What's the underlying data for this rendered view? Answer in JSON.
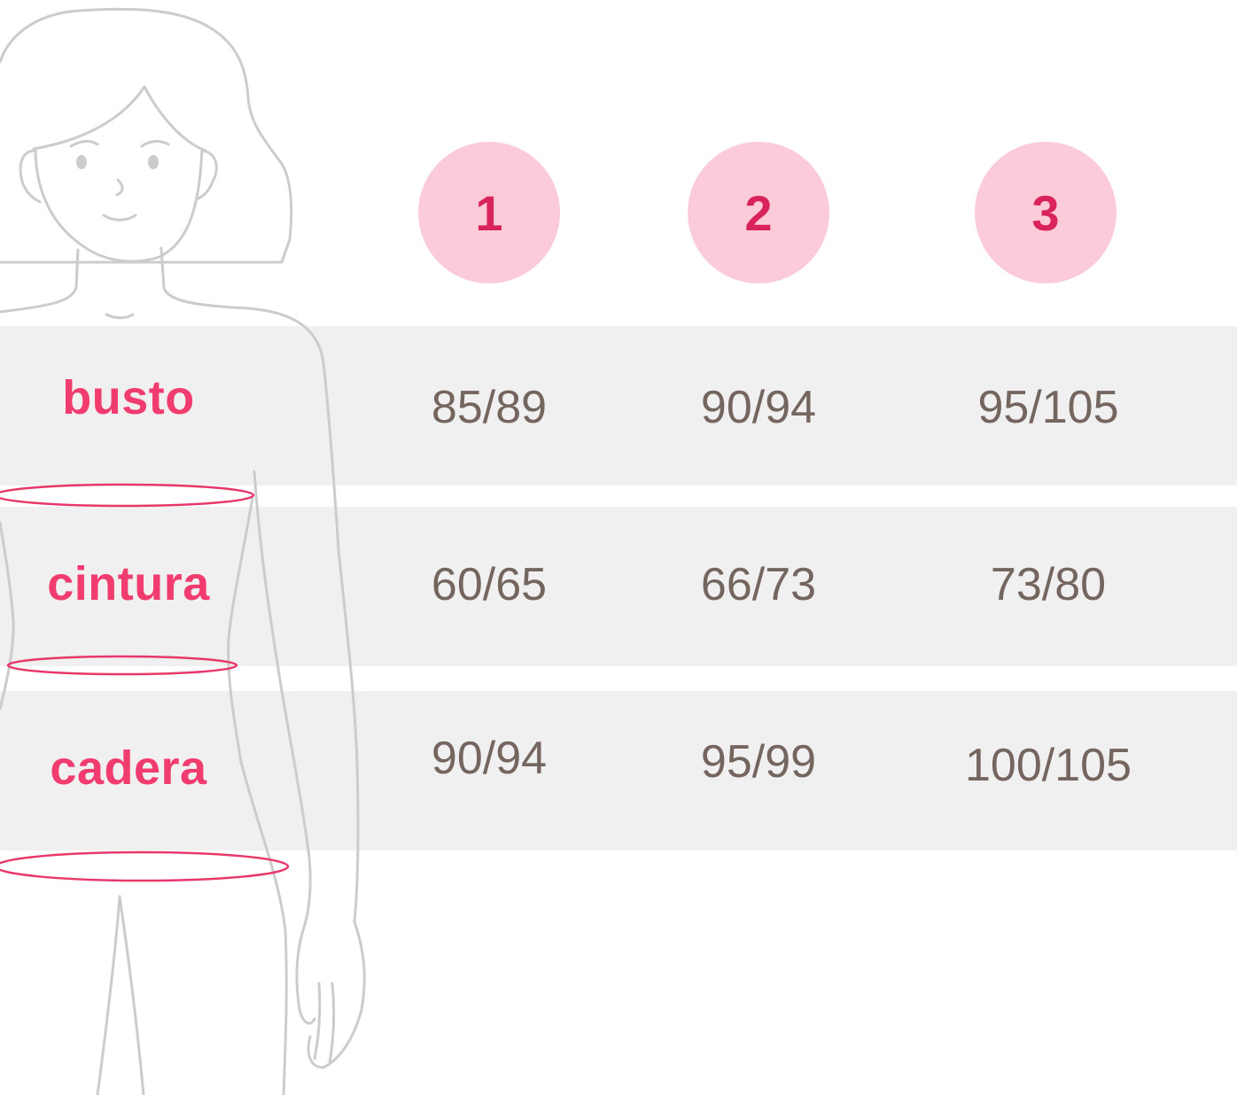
{
  "colors": {
    "label": "#f03c6e",
    "value": "#75655f",
    "badge_bg": "#fccbda",
    "badge_text": "#d8245a",
    "band": "#f0f0f0",
    "outline": "#cccccc",
    "measure_ring": "#e8386a"
  },
  "sizes": [
    "1",
    "2",
    "3"
  ],
  "rows": [
    {
      "label": "busto",
      "values": [
        "85/89",
        "90/94",
        "95/105"
      ]
    },
    {
      "label": "cintura",
      "values": [
        "60/65",
        "66/73",
        "73/80"
      ]
    },
    {
      "label": "cadera",
      "values": [
        "90/94",
        "95/99",
        "100/105"
      ]
    }
  ],
  "icons": {
    "figure": "woman-outline-figure-icon"
  }
}
